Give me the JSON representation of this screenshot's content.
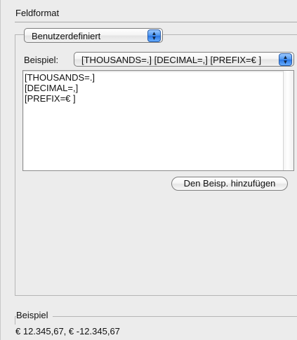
{
  "panel": {
    "title": "Feldformat"
  },
  "format_type": {
    "selected": "Benutzerdefiniert",
    "icon": "chevron-updown-icon"
  },
  "example": {
    "label": "Beispiel:",
    "selected": "[THOUSANDS=.] [DECIMAL=,] [PREFIX=€ ]",
    "icon": "chevron-updown-icon"
  },
  "editor": {
    "text": "[THOUSANDS=.]\n[DECIMAL=,]\n[PREFIX=€ ]"
  },
  "buttons": {
    "add_example": "Den Beisp. hinzufügen"
  },
  "preview": {
    "title": "Beispiel",
    "value": "€ 12.345,67, € -12.345,67"
  }
}
